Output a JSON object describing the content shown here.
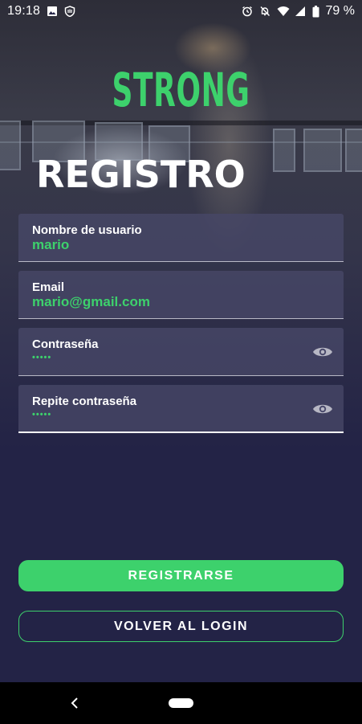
{
  "status_bar": {
    "time": "19:18",
    "battery": "79 %",
    "left_icons": [
      "image-icon",
      "shield-hand-icon"
    ],
    "right_icons": [
      "alarm-icon",
      "notifications-off-icon",
      "wifi-icon",
      "signal-icon",
      "battery-icon"
    ]
  },
  "brand": {
    "logo_text": "STRONG",
    "accent_color": "#3dd16c",
    "background_color": "#232346"
  },
  "page": {
    "title": "REGISTRO"
  },
  "form": {
    "fields": [
      {
        "label": "Nombre de usuario",
        "value": "mario"
      },
      {
        "label": "Email",
        "value": "mario@gmail.com"
      },
      {
        "label": "Contraseña",
        "value": "•••••",
        "toggle_icon": "eye-icon"
      },
      {
        "label": "Repite contraseña",
        "value": "•••••",
        "toggle_icon": "eye-icon"
      }
    ]
  },
  "actions": {
    "register_label": "REGISTRARSE",
    "back_to_login_label": "VOLVER AL LOGIN"
  },
  "nav_bar": {
    "icons": [
      "back-icon",
      "home-pill-icon"
    ]
  }
}
